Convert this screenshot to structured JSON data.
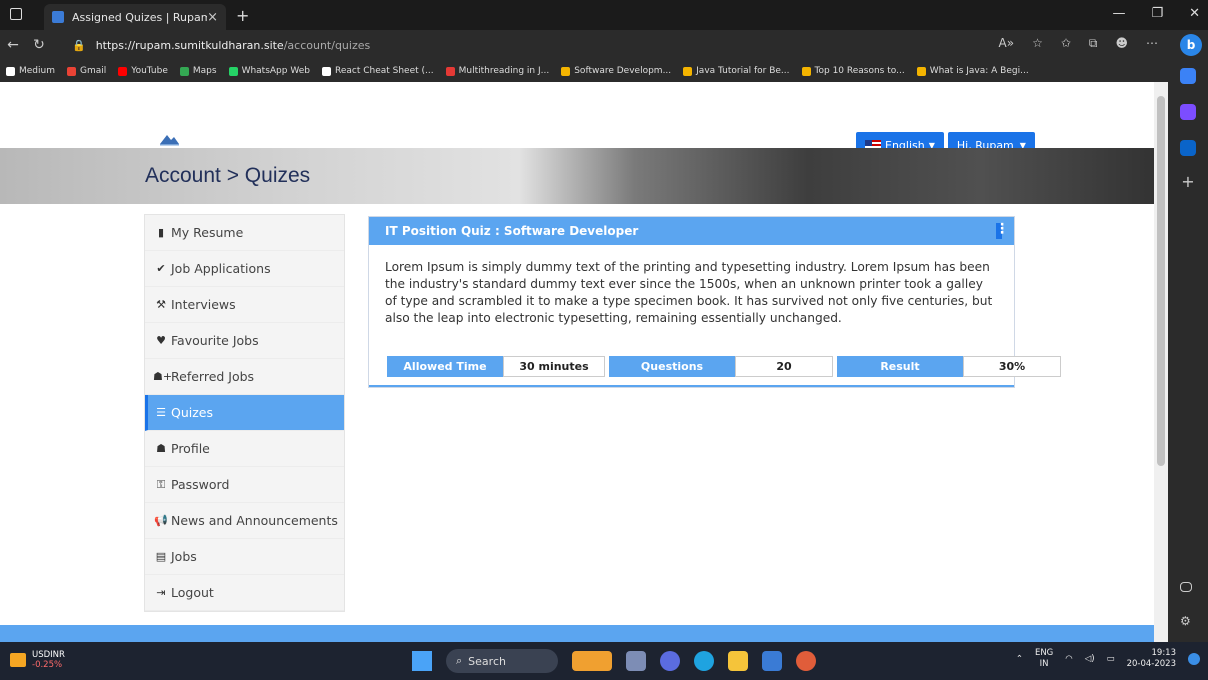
{
  "browser": {
    "tab_title": "Assigned Quizes | Rupam",
    "tab_close": "×",
    "new_tab": "+",
    "url_domain": "https://rupam.sumitkuldharan.site",
    "url_path": "/account/quizes",
    "bookmarks": [
      {
        "label": "Medium",
        "color": "#ffffff"
      },
      {
        "label": "Gmail",
        "color": "#ea4335"
      },
      {
        "label": "YouTube",
        "color": "#ff0000"
      },
      {
        "label": "Maps",
        "color": "#34a853"
      },
      {
        "label": "WhatsApp Web",
        "color": "#25d366"
      },
      {
        "label": "React Cheat Sheet (...",
        "color": "#ffffff"
      },
      {
        "label": "Multithreading in J...",
        "color": "#e53935"
      },
      {
        "label": "Software Developm...",
        "color": "#f4b400"
      },
      {
        "label": "Java Tutorial for Be...",
        "color": "#f4b400"
      },
      {
        "label": "Top 10 Reasons to...",
        "color": "#f4b400"
      },
      {
        "label": "What is Java: A Begi...",
        "color": "#f4b400"
      }
    ]
  },
  "header": {
    "language": "English",
    "user_greeting": "Hi, Rupam"
  },
  "banner": {
    "title": "Account > Quizes"
  },
  "sidebar": {
    "items": [
      {
        "label": "My Resume",
        "icon": "file-icon",
        "glyph": "▮"
      },
      {
        "label": "Job Applications",
        "icon": "check-icon",
        "glyph": "✔"
      },
      {
        "label": "Interviews",
        "icon": "gavel-icon",
        "glyph": "⚒"
      },
      {
        "label": "Favourite Jobs",
        "icon": "heart-icon",
        "glyph": "♥"
      },
      {
        "label": "Referred Jobs",
        "icon": "user-plus-icon",
        "glyph": "☗+"
      },
      {
        "label": "Quizes",
        "icon": "list-icon",
        "glyph": "☰"
      },
      {
        "label": "Profile",
        "icon": "user-icon",
        "glyph": "☗"
      },
      {
        "label": "Password",
        "icon": "key-icon",
        "glyph": "⚿"
      },
      {
        "label": "News and Announcements",
        "icon": "bullhorn-icon",
        "glyph": "📢"
      },
      {
        "label": "Jobs",
        "icon": "briefcase-icon",
        "glyph": "▤"
      },
      {
        "label": "Logout",
        "icon": "logout-icon",
        "glyph": "⇥"
      }
    ],
    "active_index": 5
  },
  "quiz_card": {
    "title": "IT Position Quiz : Software Developer",
    "description": "Lorem Ipsum is simply dummy text of the printing and typesetting industry. Lorem Ipsum has been the industry's standard dummy text ever since the 1500s, when an unknown printer took a galley of type and scrambled it to make a type specimen book. It has survived not only five centuries, but also the leap into electronic typesetting, remaining essentially unchanged.",
    "stats": [
      {
        "label": "Allowed Time",
        "value": "30 minutes"
      },
      {
        "label": "Questions",
        "value": "20"
      },
      {
        "label": "Result",
        "value": "30%"
      }
    ]
  },
  "taskbar": {
    "ticker_name": "USDINR",
    "ticker_change": "-0.25%",
    "search_label": "Search",
    "lang_top": "ENG",
    "lang_bottom": "IN",
    "time": "19:13",
    "date": "20-04-2023"
  },
  "colors": {
    "accent": "#5ba5f0",
    "primary_button": "#1a73e8",
    "title_text": "#22305a"
  }
}
